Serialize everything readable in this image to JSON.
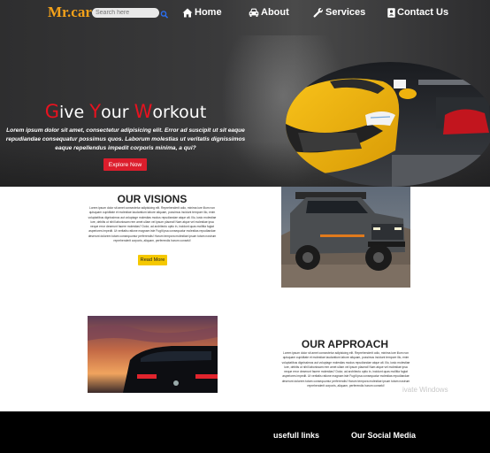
{
  "header": {
    "logo": "Mr.car",
    "search": {
      "placeholder": "Search here",
      "icon": "search-icon"
    },
    "nav": [
      {
        "label": "Home",
        "icon": "home-icon"
      },
      {
        "label": "About",
        "icon": "car-icon"
      },
      {
        "label": "Services",
        "icon": "wrench-icon"
      },
      {
        "label": "Contact Us",
        "icon": "contact-card-icon"
      }
    ]
  },
  "hero": {
    "title_parts": [
      {
        "initial": "G",
        "rest": "ive "
      },
      {
        "initial": "Y",
        "rest": "our "
      },
      {
        "initial": "W",
        "rest": "orkout"
      }
    ],
    "text": "Lorem ipsum dolor sit amet, consectetur adipisicing elit. Error ad suscipit ut sit eaque repudiandae consequatur possimus quos. Laborum molestias ut veritatis dignissimos eaque repellendus impedit corporis minima, a qui?",
    "button": "Explore Now"
  },
  "visions": {
    "title": "OUR VISIONS",
    "text": "Lorem ipsum dolor sit amet consectetur adipisicing elit. Reprehenderit odio, minima iure illum non quisquam cupiditate et molestiae laudantium labore aliquam, possimus incidunt tempore illo, enim voluptatibus dignissimos aut voluptage molestias modus repudiandae atque alt. Illo, iusto molestiae iure, debitis ut nihil laboriosam rem amet ullam vel ipsum placeat! Nam atque vel molestiae ipsa neque error deserunt facere molestias? Dolor, ad architecto optio in, incidunt quas mollitia fugiat asperiores impedit. Ut veritatis ratione magnam iste Fugit ipsa consequatur molestias repudiandae deserunt dolorem totam consequuntur perferendis! Harum tempora molestiae ipsum totam nostrum reprehenderit corporis, aliquam, perferendis harum conseki!",
    "button": "Read More"
  },
  "approach": {
    "title": "OUR APPROACH",
    "text": "Lorem ipsum dolor sit amet consectetur adipisicing elit. Reprehenderit odio, minima iure illum non quisquam cupiditate et molestiae laudantium labore aliquam, possimus incidunt tempore illo, enim voluptatibus dignissimos aut voluptage molestias modus repudiandae atque alt. Illo, iusto molestiae iure, debitis ut nihil laboriosam rem amet ullam vel ipsum placeat! Nam atque vel molestiae ipsa neque error deserunt facere molestias? Dolor, ad architecto optio in, incidunt quas mollitia fugiat asperiores impedit. Ut veritatis ratione magnam iste Fugit ipsa consequatur molestias repudiandae deserunt dolorem totam consequuntur perferendis! Harum tempora molestiae ipsum totam nostrum reprehenderit corporis, aliquam, perferendis harum conseki!"
  },
  "watermark": "ivate Windows",
  "footer": {
    "links_heading": "usefull links",
    "social_heading": "Our Social Media"
  },
  "colors": {
    "logo": "#f4a21a",
    "accent_red": "#dc1d2c",
    "read_more": "#f5c800",
    "footer_bg": "#000000"
  }
}
